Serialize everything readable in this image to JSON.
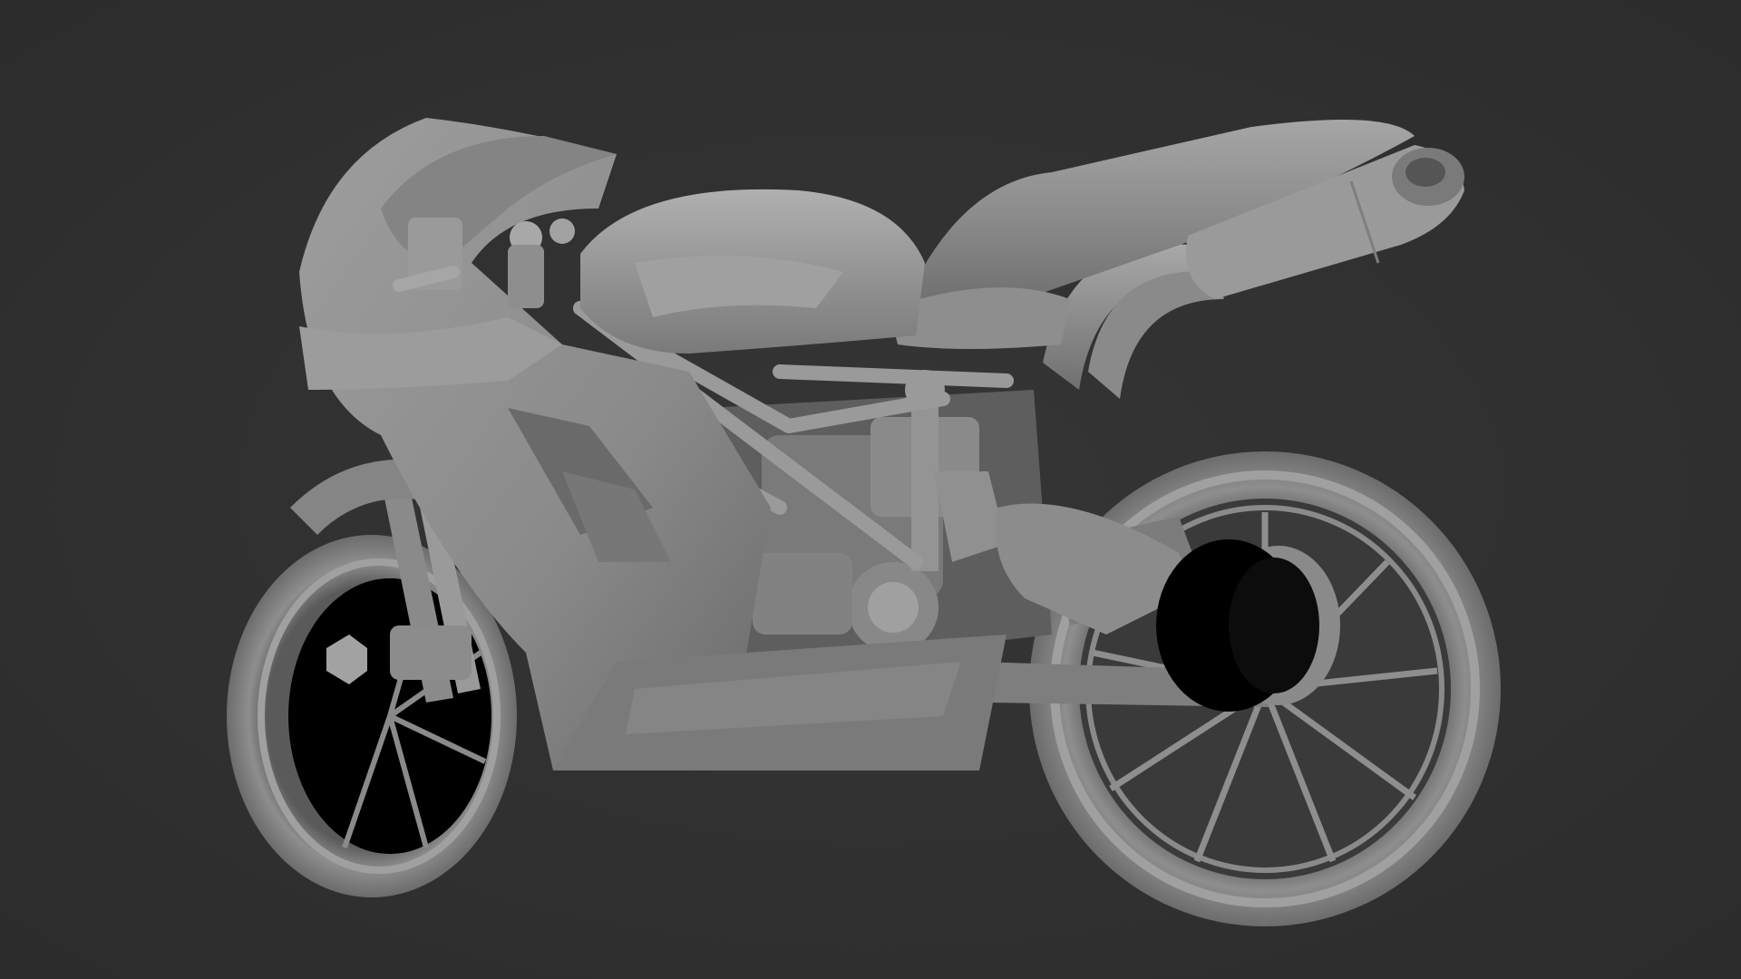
{
  "viewport": {
    "background_color": "#303030",
    "model_material_color": "#9a9a9a",
    "shadow_color": "#000000"
  },
  "model": {
    "icon": "motorcycle-icon"
  }
}
